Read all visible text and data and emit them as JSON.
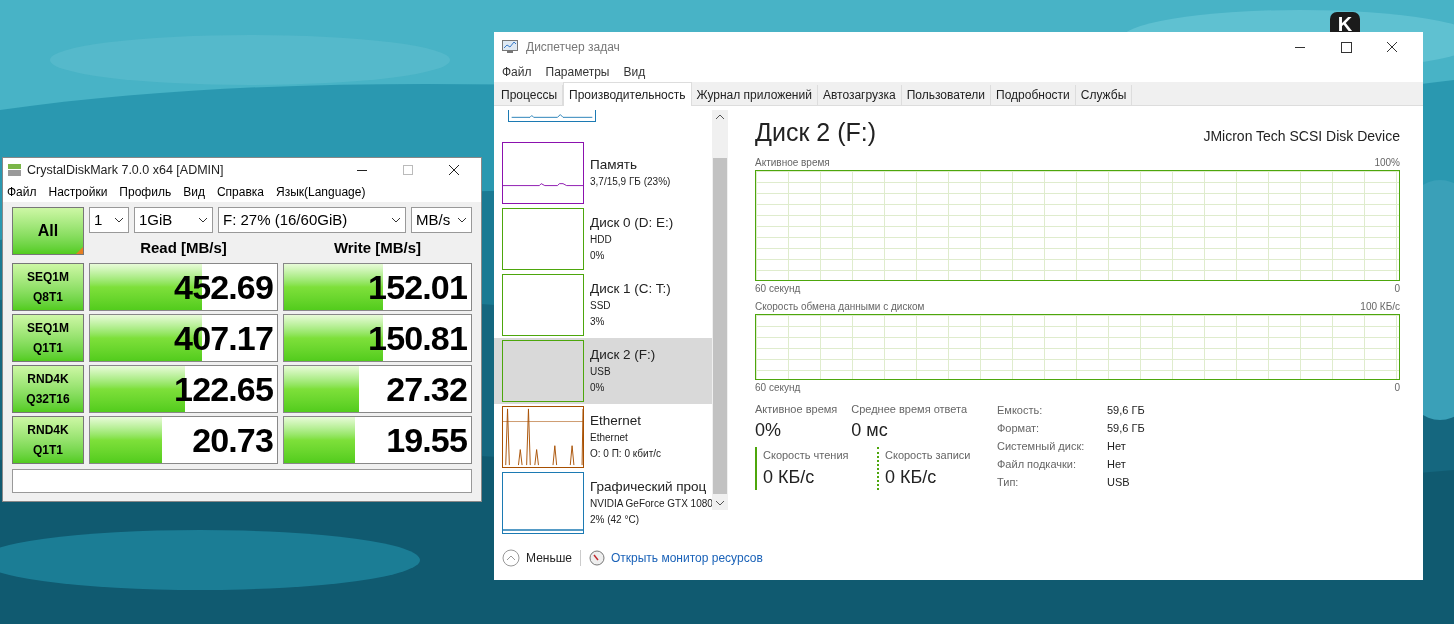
{
  "desktop_badge": "K",
  "cdm": {
    "title": "CrystalDiskMark 7.0.0 x64 [ADMIN]",
    "menu": [
      "Файл",
      "Настройки",
      "Профиль",
      "Вид",
      "Справка",
      "Язык(Language)"
    ],
    "all_button": "All",
    "selects": [
      "1",
      "1GiB",
      "F: 27% (16/60GiB)",
      "MB/s"
    ],
    "columns": [
      "Read [MB/s]",
      "Write [MB/s]"
    ],
    "rows": [
      {
        "test": [
          "SEQ1M",
          "Q8T1"
        ],
        "read": {
          "value": "452.69",
          "level": 0.6
        },
        "write": {
          "value": "152.01",
          "level": 0.53
        }
      },
      {
        "test": [
          "SEQ1M",
          "Q1T1"
        ],
        "read": {
          "value": "407.17",
          "level": 0.6
        },
        "write": {
          "value": "150.81",
          "level": 0.53
        }
      },
      {
        "test": [
          "RND4K",
          "Q32T16"
        ],
        "read": {
          "value": "122.65",
          "level": 0.51
        },
        "write": {
          "value": "27.32",
          "level": 0.4
        }
      },
      {
        "test": [
          "RND4K",
          "Q1T1"
        ],
        "read": {
          "value": "20.73",
          "level": 0.385
        },
        "write": {
          "value": "19.55",
          "level": 0.38
        }
      }
    ]
  },
  "taskmgr": {
    "title": "Диспетчер задач",
    "menu": [
      "Файл",
      "Параметры",
      "Вид"
    ],
    "tabs": [
      {
        "label": "Процессы",
        "selected": false
      },
      {
        "label": "Производительность",
        "selected": true
      },
      {
        "label": "Журнал приложений",
        "selected": false
      },
      {
        "label": "Автозагрузка",
        "selected": false
      },
      {
        "label": "Пользователи",
        "selected": false
      },
      {
        "label": "Подробности",
        "selected": false
      },
      {
        "label": "Службы",
        "selected": false
      }
    ],
    "sidebar": [
      {
        "kind": "memory",
        "name": "Память",
        "lines": [
          "3,7/15,9 ГБ (23%)"
        ],
        "color": "#8b12ae",
        "selected": false
      },
      {
        "kind": "disk",
        "name": "Диск 0 (D: E:)",
        "lines": [
          "HDD",
          "0%"
        ],
        "color": "#4da60c",
        "selected": false
      },
      {
        "kind": "disk",
        "name": "Диск 1 (C: T:)",
        "lines": [
          "SSD",
          "3%"
        ],
        "color": "#4da60c",
        "selected": false
      },
      {
        "kind": "disk",
        "name": "Диск 2 (F:)",
        "lines": [
          "USB",
          "0%"
        ],
        "color": "#4da60c",
        "selected": true
      },
      {
        "kind": "network",
        "name": "Ethernet",
        "lines": [
          "Ethernet",
          "О: 0 П: 0 кбит/с"
        ],
        "color": "#a74f01",
        "selected": false
      },
      {
        "kind": "gpu",
        "name": "Графический проц",
        "lines": [
          "NVIDIA GeForce GTX 1080",
          "2% (42 °C)"
        ],
        "color": "#1c7ab3",
        "selected": false
      }
    ],
    "main": {
      "title": "Диск 2 (F:)",
      "device": "JMicron Tech SCSI Disk Device",
      "graphs": [
        {
          "label": "Активное время",
          "max": "100%",
          "span": "60 секунд",
          "min": "0",
          "kind": "tall"
        },
        {
          "label": "Скорость обмена данными с диском",
          "max": "100 КБ/с",
          "span": "60 секунд",
          "min": "0",
          "kind": "short"
        }
      ],
      "stats": [
        {
          "label": "Активное время",
          "value": "0%"
        },
        {
          "label": "Среднее время ответа",
          "value": "0 мс"
        }
      ],
      "speeds": [
        {
          "kind": "solid",
          "label": "Скорость чтения",
          "value": "0 КБ/с"
        },
        {
          "kind": "dotted",
          "label": "Скорость записи",
          "value": "0 КБ/с"
        }
      ],
      "properties": [
        {
          "label": "Емкость:",
          "value": "59,6 ГБ"
        },
        {
          "label": "Формат:",
          "value": "59,6 ГБ"
        },
        {
          "label": "Системный диск:",
          "value": "Нет"
        },
        {
          "label": "Файл подкачки:",
          "value": "Нет"
        },
        {
          "label": "Тип:",
          "value": "USB"
        }
      ]
    },
    "footer": {
      "less": "Меньше",
      "link": "Открыть монитор ресурсов"
    }
  }
}
